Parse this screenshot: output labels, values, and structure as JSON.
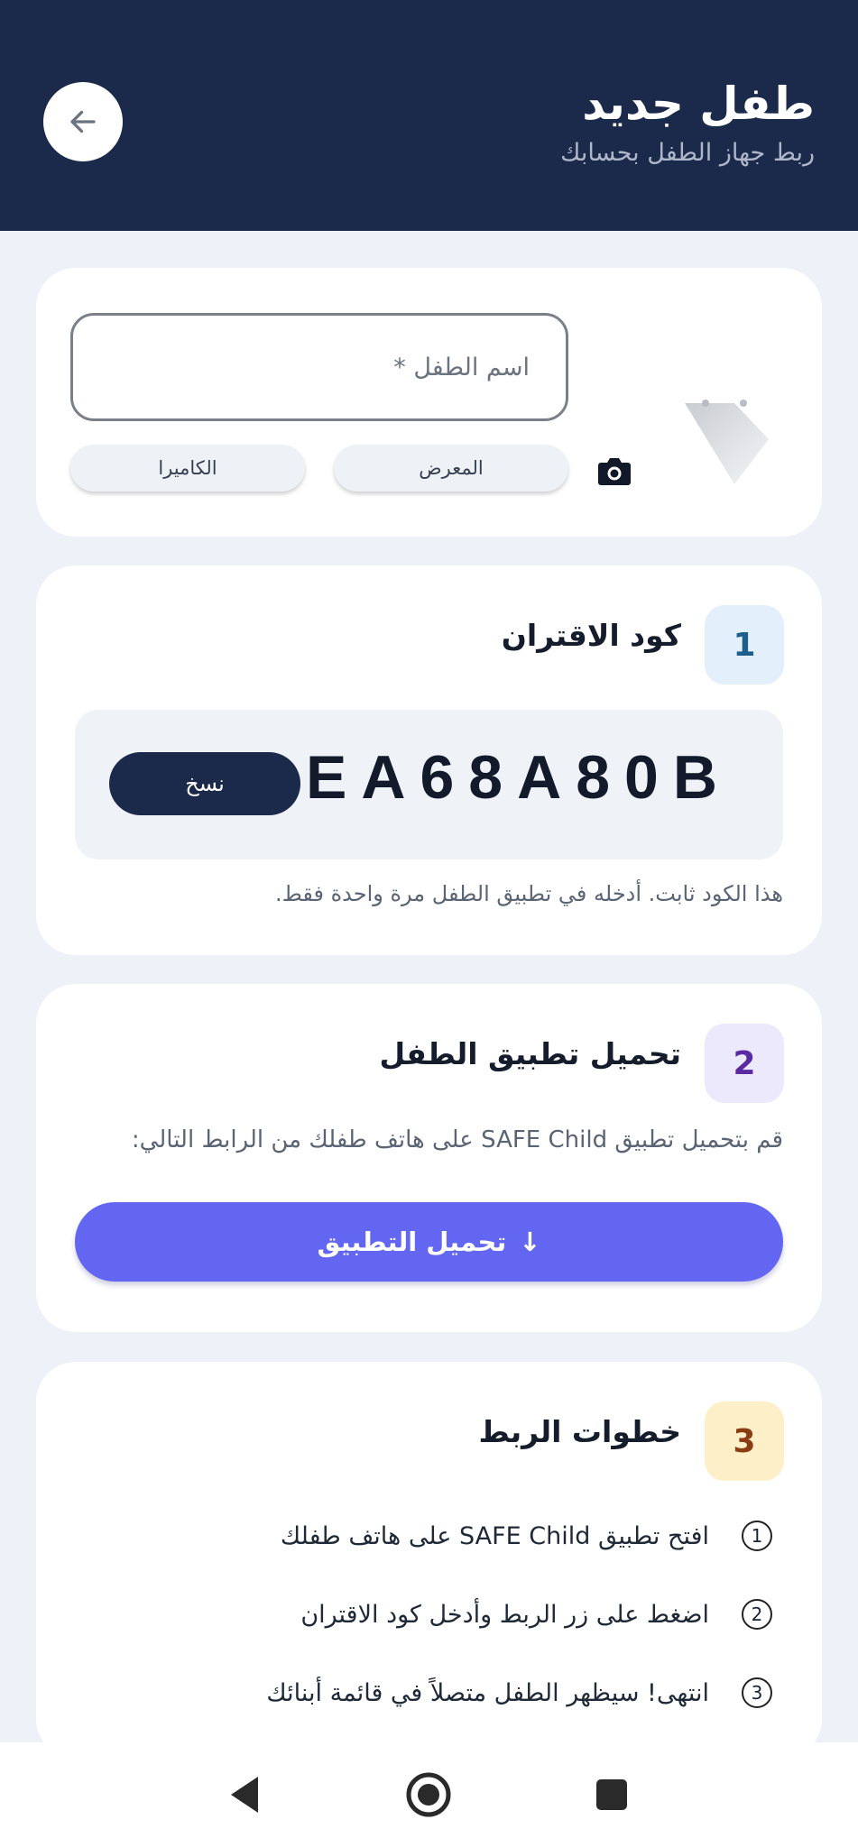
{
  "header": {
    "title": "طفل جديد",
    "subtitle": "ربط جهاز الطفل بحسابك",
    "back_icon": "arrow-left-icon"
  },
  "profile": {
    "name_placeholder": "اسم الطفل *",
    "name_value": "",
    "gallery_label": "المعرض",
    "camera_label": "الكاميرا",
    "camera_icon": "camera-icon",
    "avatar_icon": "avatar-placeholder-icon"
  },
  "pairing": {
    "step_number": "1",
    "title": "كود الاقتران",
    "code": "EA68A80B",
    "copy_label": "نسخ",
    "note": "هذا الكود ثابت. أدخله في تطبيق الطفل مرة واحدة فقط."
  },
  "download": {
    "step_number": "2",
    "title": "تحميل تطبيق الطفل",
    "description": "قم بتحميل تطبيق SAFE Child على هاتف طفلك من الرابط التالي:",
    "button_label": "تحميل التطبيق",
    "button_icon": "↓"
  },
  "steps": {
    "step_number": "3",
    "title": "خطوات الربط",
    "items": [
      {
        "num": "1",
        "text": "افتح تطبيق SAFE Child على هاتف طفلك"
      },
      {
        "num": "2",
        "text": "اضغط على زر الربط وأدخل كود الاقتران"
      },
      {
        "num": "3",
        "text": "انتهى! سيظهر الطفل متصلاً في قائمة أبنائك"
      }
    ]
  },
  "colors": {
    "header_bg": "#1b2a4a",
    "accent": "#6366f1",
    "badge1_bg": "#e3f0fc",
    "badge1_fg": "#1d5e8c",
    "badge2_bg": "#ede9fc",
    "badge2_fg": "#5b2aa3",
    "badge3_bg": "#fdf0c8",
    "badge3_fg": "#8a3d12"
  }
}
